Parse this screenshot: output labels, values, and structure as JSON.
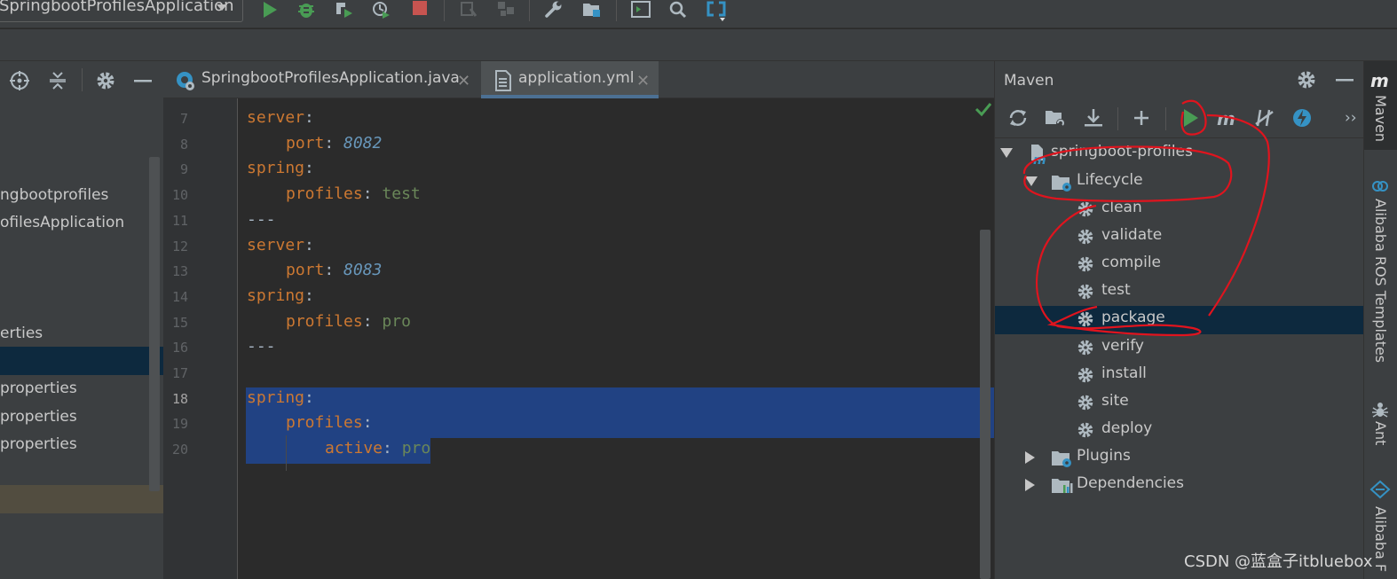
{
  "toolbar": {
    "run_config": "SpringbootProfilesApplication",
    "icons": [
      "run-icon",
      "debug-icon",
      "coverage-icon",
      "profile-icon",
      "stop-icon",
      "build-icon",
      "project-structure-icon",
      "settings-wrench-icon",
      "folder-settings-icon",
      "terminal-icon",
      "search-icon",
      "vcs-icon"
    ]
  },
  "project_panel": {
    "items": [
      "ngbootprofiles",
      "ofilesApplication",
      "erties",
      "properties",
      "properties",
      "properties"
    ]
  },
  "editor": {
    "tabs": [
      {
        "label": "SpringbootProfilesApplication.java",
        "active": false
      },
      {
        "label": "application.yml",
        "active": true
      }
    ],
    "line_numbers": [
      "7",
      "8",
      "9",
      "10",
      "11",
      "12",
      "13",
      "14",
      "15",
      "16",
      "17",
      "18",
      "19",
      "20"
    ],
    "current_line": "18",
    "lines": [
      {
        "key": "server",
        "punct": ":",
        "value": "",
        "value_type": ""
      },
      {
        "key": "port",
        "punct": ": ",
        "value": "8082",
        "value_type": "number"
      },
      {
        "key": "spring",
        "punct": ":",
        "value": "",
        "value_type": ""
      },
      {
        "key": "profiles",
        "punct": ": ",
        "value": "test",
        "value_type": "string"
      },
      {
        "key": "",
        "punct": "---",
        "value": "",
        "value_type": ""
      },
      {
        "key": "server",
        "punct": ":",
        "value": "",
        "value_type": ""
      },
      {
        "key": "port",
        "punct": ": ",
        "value": "8083",
        "value_type": "number"
      },
      {
        "key": "spring",
        "punct": ":",
        "value": "",
        "value_type": ""
      },
      {
        "key": "profiles",
        "punct": ": ",
        "value": "pro",
        "value_type": "string"
      },
      {
        "key": "",
        "punct": "---",
        "value": "",
        "value_type": ""
      },
      {
        "key": "",
        "punct": "",
        "value": "",
        "value_type": ""
      },
      {
        "key": "spring",
        "punct": ":",
        "value": "",
        "value_type": ""
      },
      {
        "key": "profiles",
        "punct": ":",
        "value": "",
        "value_type": ""
      },
      {
        "key": "active",
        "punct": ": ",
        "value": "pro",
        "value_type": "string"
      }
    ]
  },
  "maven": {
    "title": "Maven",
    "project": "springboot-profiles",
    "lifecycle": "Lifecycle",
    "goals": [
      "clean",
      "validate",
      "compile",
      "test",
      "package",
      "verify",
      "install",
      "site",
      "deploy"
    ],
    "selected_goal": "package",
    "plugins": "Plugins",
    "dependencies": "Dependencies"
  },
  "right_strip": {
    "tabs": [
      "Maven",
      "Alibaba ROS Templates",
      "Ant",
      "Alibaba F"
    ]
  },
  "watermark": "CSDN @蓝盒子itbluebox",
  "colors": {
    "keyword": "#cc7832",
    "string": "#6a8759",
    "number": "#6897bb",
    "selection": "#214283",
    "annotation": "#e0141e"
  }
}
